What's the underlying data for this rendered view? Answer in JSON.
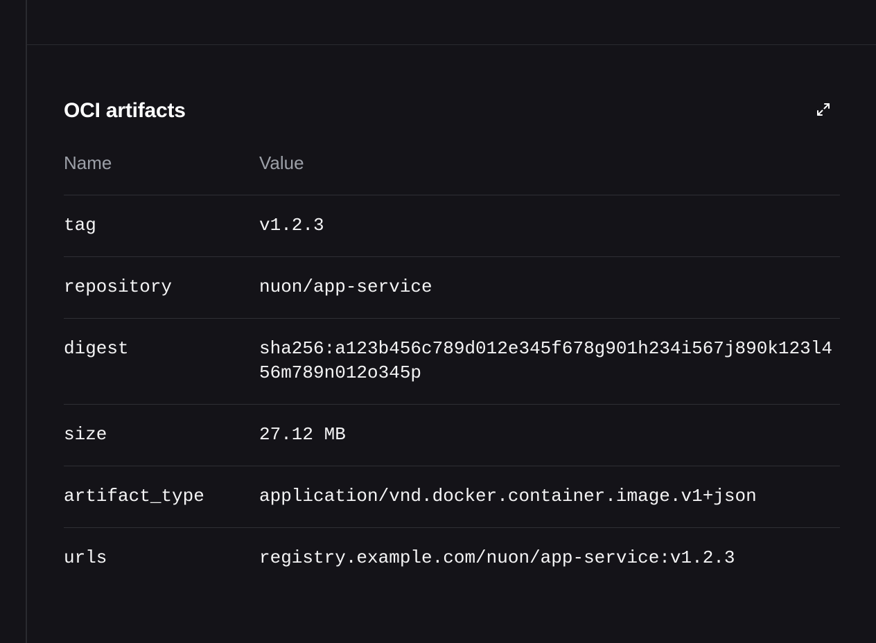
{
  "panel": {
    "title": "OCI artifacts",
    "expand_icon": "expand-arrows-icon"
  },
  "table": {
    "headers": {
      "name": "Name",
      "value": "Value"
    },
    "rows": [
      {
        "name": "tag",
        "value": "v1.2.3"
      },
      {
        "name": "repository",
        "value": "nuon/app-service"
      },
      {
        "name": "digest",
        "value": "sha256:a123b456c789d012e345f678g901h234i567j890k123l456m789n012o345p"
      },
      {
        "name": "size",
        "value": "27.12 MB"
      },
      {
        "name": "artifact_type",
        "value": "application/vnd.docker.container.image.v1+json"
      },
      {
        "name": "urls",
        "value": "registry.example.com/nuon/app-service:v1.2.3"
      }
    ]
  }
}
